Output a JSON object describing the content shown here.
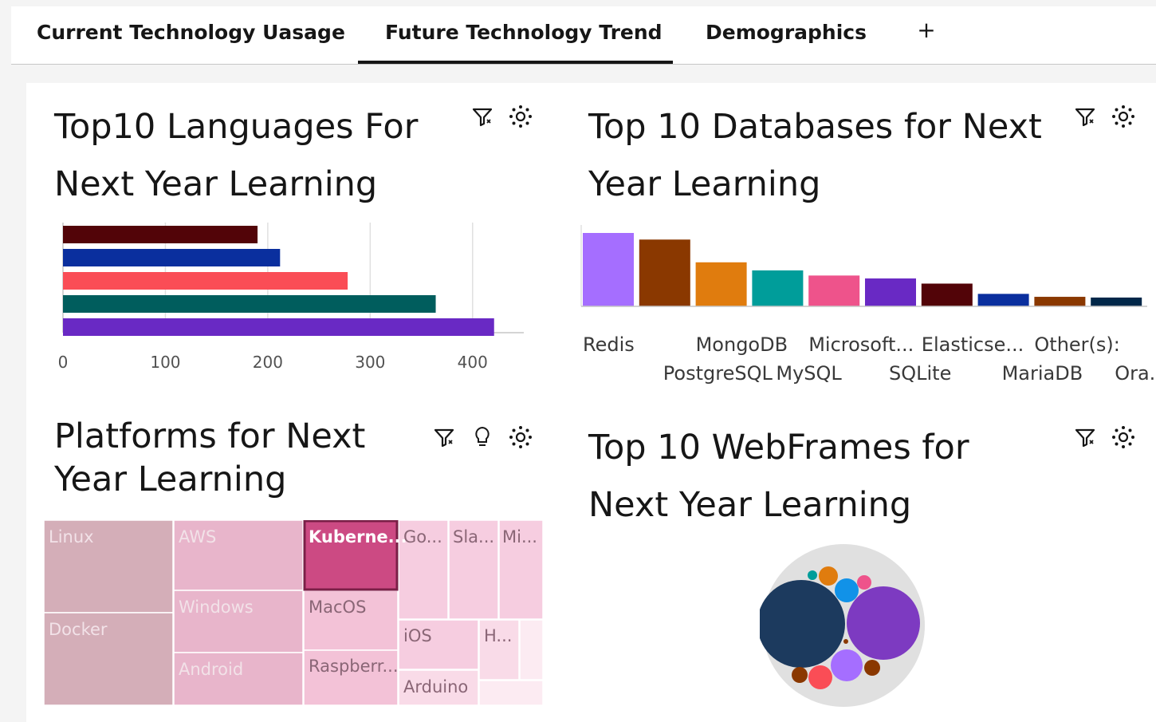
{
  "tabs": [
    {
      "label": "Current Technology  Uasage",
      "active": false
    },
    {
      "label": "Future Technology  Trend",
      "active": true
    },
    {
      "label": "Demographics",
      "active": false
    }
  ],
  "add_tab_label": "+",
  "widgets": {
    "languages": {
      "title_line1": "Top10 Languages For",
      "title_line2": "Next Year Learning"
    },
    "databases": {
      "title_line1": "Top 10 Databases for Next",
      "title_line2": "Year Learning"
    },
    "platforms": {
      "title_line1": "Platforms for Next",
      "title_line2": "Year Learning"
    },
    "webframes": {
      "title_line1": "Top 10 WebFrames for",
      "title_line2": "Next Year Learning"
    }
  },
  "icons": {
    "filter": "filter-icon",
    "settings": "settings-icon",
    "insight": "lightbulb-icon"
  },
  "chart_data": [
    {
      "id": "languages",
      "type": "bar",
      "orientation": "horizontal",
      "x_ticks": [
        "0",
        "100",
        "200",
        "300",
        "400"
      ],
      "xlim": [
        0,
        450
      ],
      "values": [
        190,
        212,
        278,
        364,
        421
      ],
      "colors": [
        "#520408",
        "#0a2f9e",
        "#fa4d56",
        "#005d5d",
        "#6929c4"
      ],
      "grid": true
    },
    {
      "id": "databases",
      "type": "bar",
      "categories": [
        "Redis",
        "PostgreSQL",
        "MongoDB",
        "MySQL",
        "Microsoft...",
        "SQLite",
        "Elasticse...",
        "MariaDB",
        "Other(s):",
        "Ora..."
      ],
      "values": [
        100,
        91,
        60,
        49,
        42,
        38,
        31,
        17,
        13,
        12
      ],
      "colors": [
        "#a56eff",
        "#8a3800",
        "#e07c0e",
        "#009d9a",
        "#ee538b",
        "#6929c4",
        "#520408",
        "#0a2f9e",
        "#8a3800",
        "#012749"
      ],
      "grid": false
    },
    {
      "id": "platforms",
      "type": "treemap",
      "labels": [
        "Linux",
        "Docker",
        "AWS",
        "Windows",
        "Android",
        "Kuberne...",
        "MacOS",
        "Raspberr...",
        "Go...",
        "Sla...",
        "Mi...",
        "iOS",
        "H...",
        "Arduino"
      ],
      "highlighted": "Kuberne..."
    },
    {
      "id": "webframes",
      "type": "bubble",
      "colors": [
        "#1c3a5e",
        "#7d3ac1",
        "#1192e8",
        "#e07c0e",
        "#ee538b",
        "#a56eff",
        "#fa4d56",
        "#8a3800",
        "#009d9a"
      ]
    }
  ]
}
